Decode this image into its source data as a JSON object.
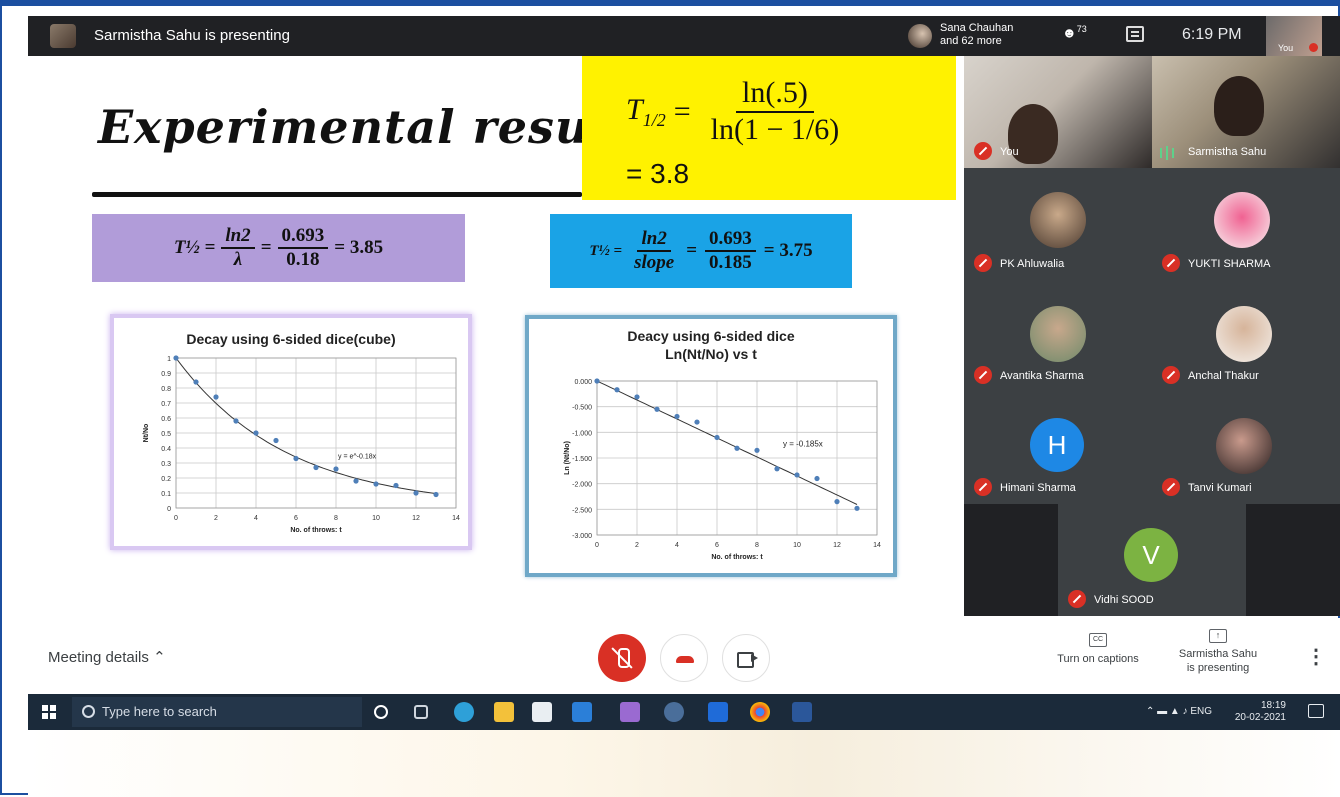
{
  "topbar": {
    "presenting": "Sarmistha Sahu is presenting",
    "others_line1": "Sana Chauhan",
    "others_line2": "and 62 more",
    "people_count": "73",
    "clock": "6:19 PM",
    "self_thumb_label": "You"
  },
  "slide": {
    "title": "Experimental result",
    "main_formula": {
      "lhs": "T",
      "lhs_sub": "1/2",
      "num": "ln(.5)",
      "den": "ln(1 − 1/6)",
      "result": "= 3.8"
    },
    "purple_formula": {
      "lhs": "T½ =",
      "f1_num": "ln2",
      "f1_den": "λ",
      "f2_num": "0.693",
      "f2_den": "0.18",
      "result": "= 3.85"
    },
    "blue_formula": {
      "lhs": "T½ =",
      "f1_num": "ln2",
      "f1_den": "slope",
      "f2_num": "0.693",
      "f2_den": "0.185",
      "result": "= 3.75"
    }
  },
  "chart_data": [
    {
      "type": "scatter",
      "title": "Decay using 6-sided dice(cube)",
      "xlabel": "No. of throws: t",
      "ylabel": "Nt/No",
      "xlim": [
        0,
        14
      ],
      "ylim": [
        0,
        1
      ],
      "xticks": [
        "0",
        "2",
        "4",
        "6",
        "8",
        "10",
        "12",
        "14"
      ],
      "yticks": [
        "0",
        "0.1",
        "0.2",
        "0.3",
        "0.4",
        "0.5",
        "0.6",
        "0.7",
        "0.8",
        "0.9",
        "1"
      ],
      "x": [
        0,
        1,
        2,
        3,
        4,
        5,
        6,
        7,
        8,
        9,
        10,
        11,
        12,
        13
      ],
      "values": [
        1.0,
        0.84,
        0.74,
        0.58,
        0.5,
        0.45,
        0.33,
        0.27,
        0.26,
        0.18,
        0.16,
        0.15,
        0.1,
        0.09
      ],
      "trendline": "exponential",
      "trend_k": 0.18,
      "annotation": "y = e^-0.18x",
      "grid": true,
      "point_color": "#4f7fb8"
    },
    {
      "type": "scatter",
      "title": "Deacy using 6-sided dice",
      "subtitle": "Ln(Nt/No) vs t",
      "xlabel": "No. of throws: t",
      "ylabel": "Ln (Nt/No)",
      "xlim": [
        0,
        14
      ],
      "ylim": [
        -3,
        0
      ],
      "xticks": [
        "0",
        "2",
        "4",
        "6",
        "8",
        "10",
        "12",
        "14"
      ],
      "yticks": [
        "0.000",
        "-0.500",
        "-1.000",
        "-1.500",
        "-2.000",
        "-2.500",
        "-3.000"
      ],
      "x": [
        0,
        1,
        2,
        3,
        4,
        5,
        6,
        7,
        8,
        9,
        10,
        11,
        12,
        13
      ],
      "values": [
        0,
        -0.17,
        -0.31,
        -0.55,
        -0.69,
        -0.8,
        -1.1,
        -1.31,
        -1.35,
        -1.71,
        -1.83,
        -1.9,
        -2.35,
        -2.48
      ],
      "trendline": "linear",
      "trend_slope": -0.185,
      "annotation": "y = -0.185x",
      "grid": true,
      "point_color": "#4f7fb8"
    }
  ],
  "participants": [
    {
      "name": "You",
      "muted": true
    },
    {
      "name": "Sarmistha Sahu",
      "muted": false
    },
    {
      "name": "PK Ahluwalia",
      "muted": true
    },
    {
      "name": "YUKTI SHARMA",
      "muted": true
    },
    {
      "name": "Avantika Sharma",
      "muted": true
    },
    {
      "name": "Anchal Thakur",
      "muted": true
    },
    {
      "name": "Himani Sharma",
      "muted": true,
      "initial": "H"
    },
    {
      "name": "Tanvi Kumari",
      "muted": true
    },
    {
      "name": "Vidhi SOOD",
      "muted": true,
      "initial": "V"
    }
  ],
  "controls": {
    "meeting_details": "Meeting details",
    "captions": "Turn on captions",
    "captions_icon": "CC",
    "presenting_line1": "Sarmistha Sahu",
    "presenting_line2": "is presenting"
  },
  "taskbar": {
    "search_placeholder": "Type here to search",
    "tray_lang": "ENG",
    "time": "18:19",
    "date": "20-02-2021"
  },
  "colors": {
    "yellow": "#fff200",
    "purple": "#b19cd9",
    "blue": "#1aa3e6",
    "meet_red": "#d93025",
    "panel_bg": "#3c4043"
  }
}
